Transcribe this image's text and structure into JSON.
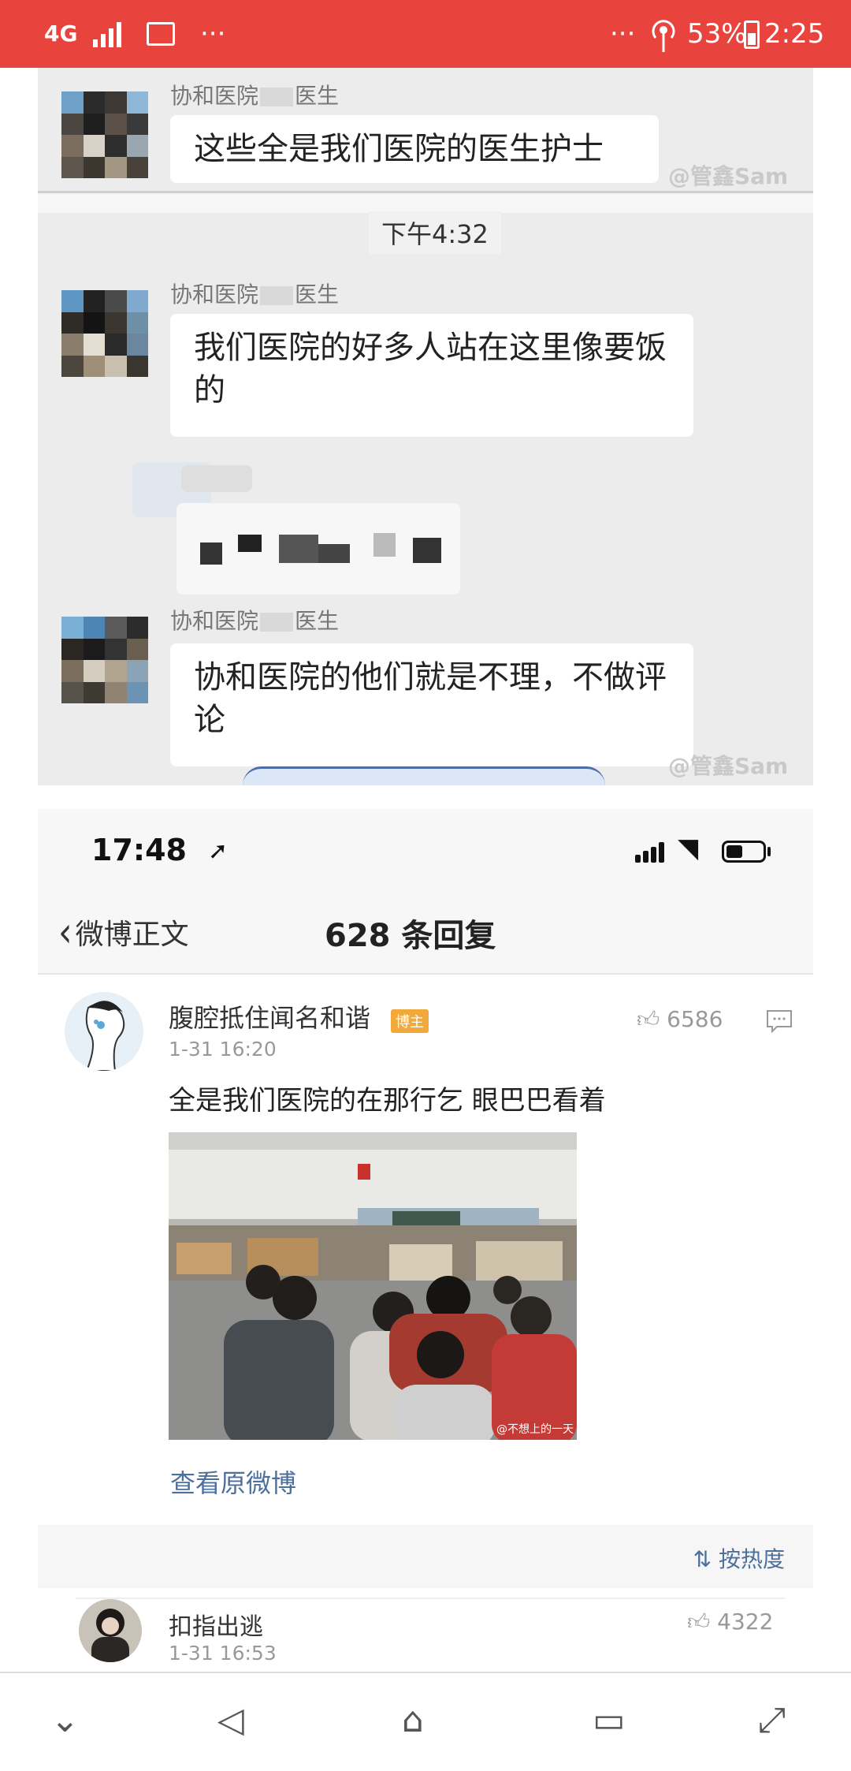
{
  "statusbar": {
    "network": "4G",
    "more_left": "···",
    "more_right": "···",
    "battery": "53%",
    "time": "2:25"
  },
  "chat": {
    "sender_name_1": "协和医院",
    "sender_name_1_suffix": "医生",
    "message_1": "这些全是我们医院的医生护士",
    "time_divider": "下午4:32",
    "sender_name_2": "协和医院",
    "sender_name_2_suffix": "医生",
    "message_2": "我们医院的好多人站在这里像要饭的",
    "sender_name_3": "协和医院",
    "sender_name_3_suffix": "医生",
    "message_3": "协和医院的他们就是不理，不做评论",
    "watermark": "@管鑫Sam"
  },
  "weibo": {
    "ios_time": "17:48",
    "back_label": "微博正文",
    "title": "628 条回复",
    "comment_1": {
      "user": "腹腔抵住闻名和谐",
      "badge": "博主",
      "time": "1-31 16:20",
      "likes": "6586",
      "text": "全是我们医院的在那行乞  眼巴巴看着",
      "image_watermark": "@不想上的一天",
      "view_original": "查看原微博"
    },
    "sort_label": "按热度",
    "comment_2": {
      "user": "扣指出逃",
      "time": "1-31 16:53",
      "likes": "4322"
    }
  },
  "colors": {
    "status_red": "#e8433d",
    "link_blue": "#4d6f9b",
    "badge_orange": "#f2a93b"
  }
}
